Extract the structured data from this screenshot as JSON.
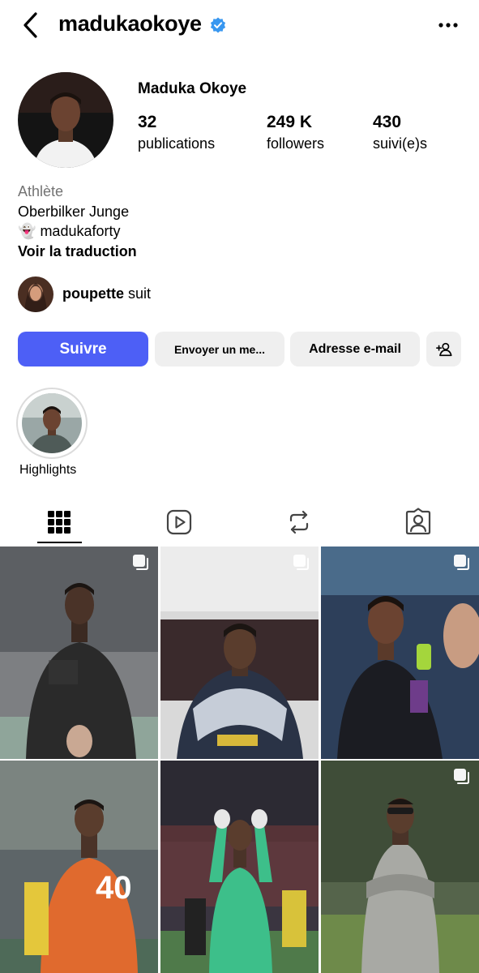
{
  "header": {
    "username": "madukaokoye"
  },
  "profile": {
    "full_name": "Maduka Okoye",
    "stats": [
      {
        "value": "32",
        "label": "publications"
      },
      {
        "value": "249 K",
        "label": "followers"
      },
      {
        "value": "430",
        "label": "suivi(e)s"
      }
    ],
    "bio": {
      "category": "Athlète",
      "line1": "Oberbilker Junge",
      "snap_emoji": "👻",
      "snap_handle": "madukaforty",
      "translate": "Voir la traduction"
    },
    "followed_by": {
      "name": "poupette",
      "suffix": " suit"
    }
  },
  "actions": {
    "follow": "Suivre",
    "message": "Envoyer un me...",
    "email": "Adresse e-mail"
  },
  "highlights": [
    {
      "label": "Highlights"
    }
  ],
  "tabs": [
    "posts-grid",
    "reels",
    "reposts",
    "tagged"
  ],
  "colors": {
    "accent": "#4d5ff6",
    "button_bg": "#efefef",
    "muted": "#737373",
    "verified": "#3897f0"
  }
}
